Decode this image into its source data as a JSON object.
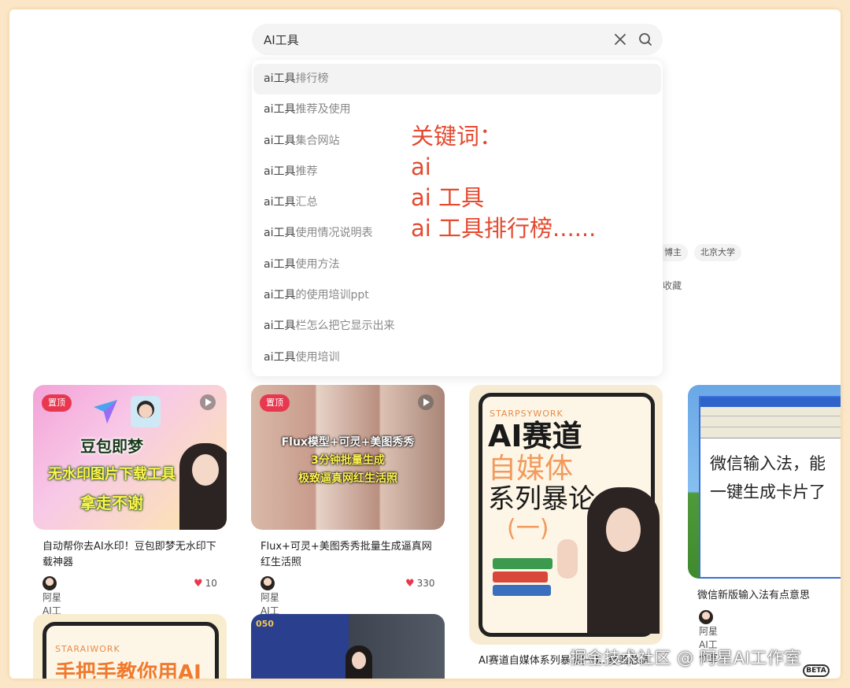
{
  "search": {
    "query": "AI工具"
  },
  "suggestions": [
    {
      "prefix": "ai工具",
      "rest": "排行榜"
    },
    {
      "prefix": "ai工具",
      "rest": "推荐及使用"
    },
    {
      "prefix": "ai工具",
      "rest": "集合网站"
    },
    {
      "prefix": "ai工具",
      "rest": "推荐"
    },
    {
      "prefix": "ai工具",
      "rest": "汇总"
    },
    {
      "prefix": "ai工具",
      "rest": "使用情况说明表"
    },
    {
      "prefix": "ai工具",
      "rest": "使用方法"
    },
    {
      "prefix": "ai工具",
      "rest": "的使用培训ppt"
    },
    {
      "prefix": "ai工具",
      "rest": "栏怎么把它显示出来"
    },
    {
      "prefix": "ai工具",
      "rest": "使用培训"
    }
  ],
  "background": {
    "tag1": "博主",
    "tag2": "北京大学",
    "fav": "收藏"
  },
  "annotation": {
    "line1": "关键词：",
    "line2": "ai",
    "line3": "ai 工具",
    "line4": "ai 工具排行榜......"
  },
  "cards": [
    {
      "pin": "置顶",
      "thumb_lines": [
        "豆包即梦",
        "无水印图片下载工具",
        "拿走不谢"
      ],
      "title": "自动帮你去AI水印！豆包即梦无水印下载神器",
      "author": "阿星AI工作室",
      "likes": "10"
    },
    {
      "pin": "置顶",
      "thumb_lines": [
        "Flux模型+可灵+美图秀秀",
        "3分钟批量生成",
        "极致逼真网红生活照"
      ],
      "title": "Flux+可灵+美图秀秀批量生成逼真网红生活照",
      "author": "阿星AI工作室",
      "likes": "330"
    },
    {
      "thumb_lines": [
        "STARPSYWORK",
        "AI赛道",
        "自媒体",
        "系列暴论",
        "(一)"
      ],
      "title": "AI赛道自媒体系列暴论(一)...经验总结"
    },
    {
      "thumb_lines": [
        "微信输入法，能",
        "一键生成卡片了"
      ],
      "title": "微信新版输入法有点意思",
      "author": "阿星AI工作室"
    },
    {
      "thumb_lines": [
        "STARAIWORK",
        "手把手教你用AI"
      ]
    },
    {
      "thumb_lines": [
        "050"
      ]
    }
  ],
  "watermark": "掘金技术社区 @ 阿星AI工作室",
  "beta": "BETA",
  "colors": {
    "accent_red": "#e34a2f",
    "pin_red": "#e8384f",
    "frame_glow": "#fbe7c8"
  }
}
